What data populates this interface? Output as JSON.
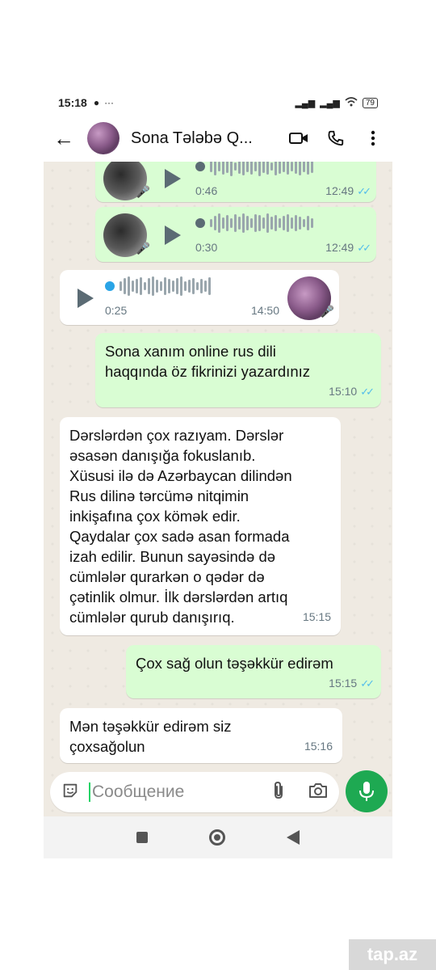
{
  "status_bar": {
    "time": "15:18",
    "battery": "79"
  },
  "header": {
    "title": "Sona Tələbə Q..."
  },
  "messages": {
    "voice1": {
      "duration": "0:46",
      "time": "12:49"
    },
    "voice2": {
      "duration": "0:30",
      "time": "12:49"
    },
    "voice3": {
      "duration": "0:25",
      "time": "14:50"
    },
    "m1": {
      "line1": "Sona xanım online rus dili",
      "line2": "haqqında öz fikrinizi yazardınız",
      "time": "15:10"
    },
    "m2": {
      "lines": [
        "Dərslərdən çox razıyam. Dərslər",
        "əsasən danışığa fokuslanıb.",
        "Xüsusi ilə də Azərbaycan dilindən",
        "Rus dilinə tərcümə nitqimin",
        "inkişafına çox kömək edir.",
        "Qaydalar çox sadə asan formada",
        "izah edilir. Bunun sayəsində də",
        "cümlələr qurarkən o qədər də",
        "çətinlik olmur. İlk dərslərdən artıq",
        "cümlələr qurub danışırıq."
      ],
      "time": "15:15"
    },
    "m3": {
      "text": "Çox sağ olun təşəkkür edirəm",
      "time": "15:15"
    },
    "m4": {
      "line1": "Mən təşəkkür edirəm siz",
      "line2": "çoxsağolun",
      "time": "15:16"
    }
  },
  "composer": {
    "placeholder": "Сообщение"
  },
  "watermark": "tap.az"
}
